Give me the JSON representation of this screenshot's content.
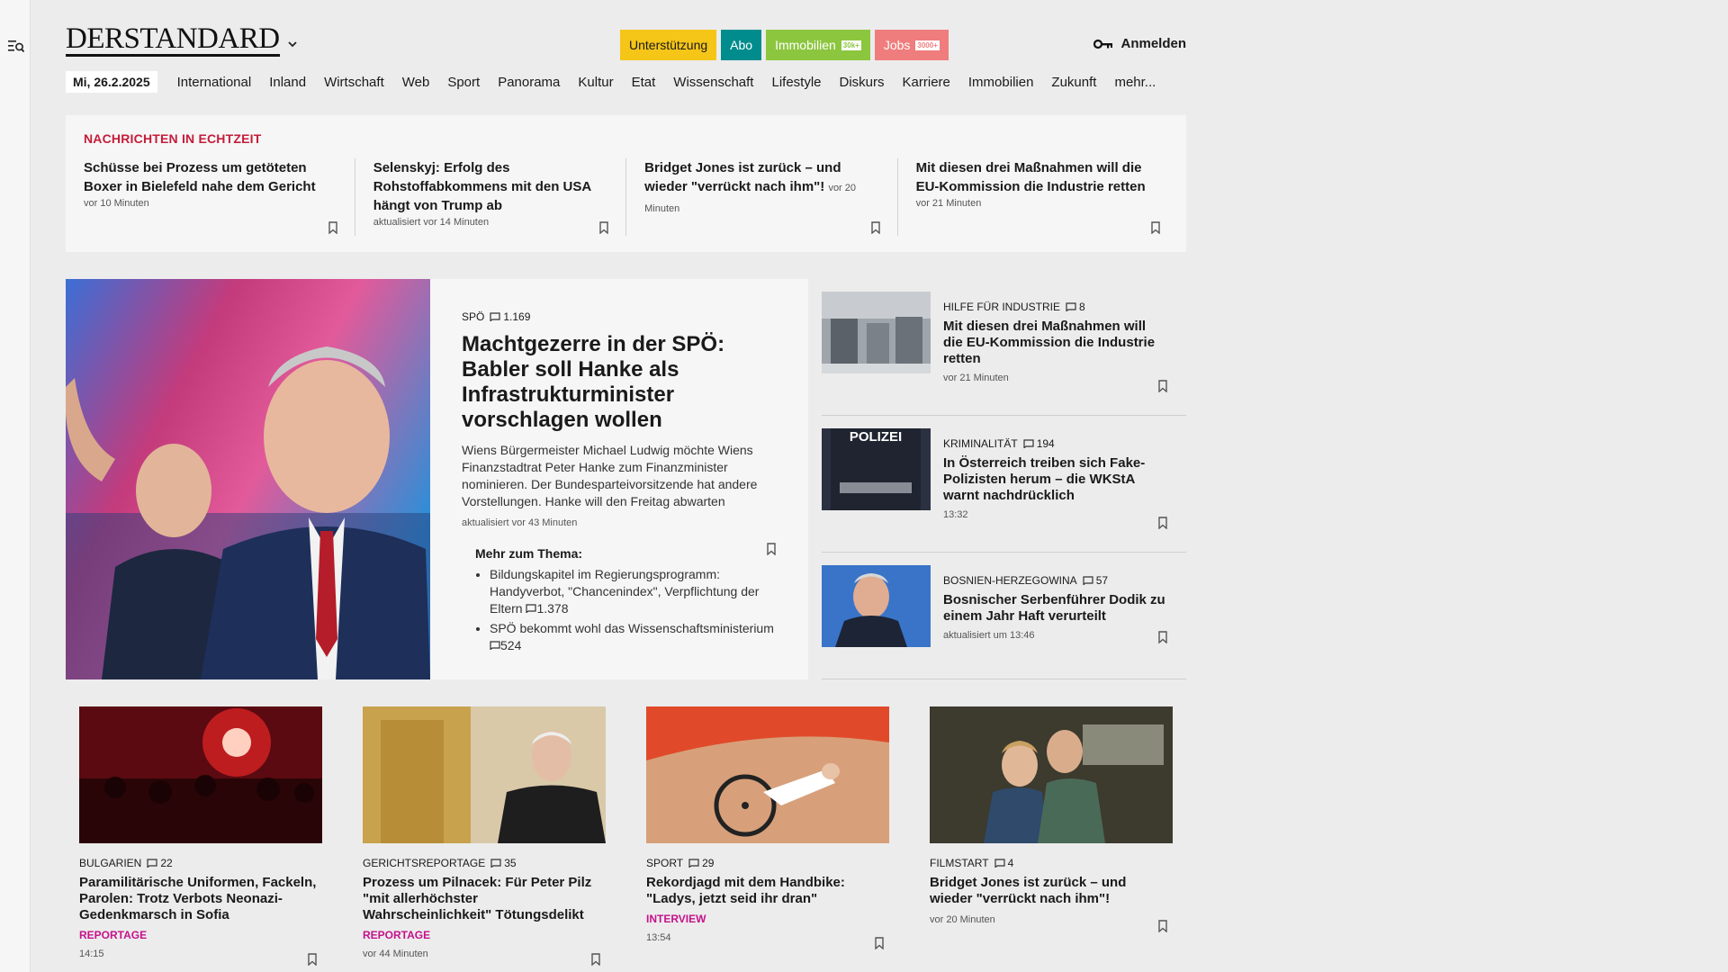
{
  "header": {
    "logo": "DERSTANDARD",
    "promo": [
      {
        "label": "Unterstützung",
        "bg": "#f5c518",
        "fg": "#1a1a1a",
        "tag": ""
      },
      {
        "label": "Abo",
        "bg": "#008c8c",
        "fg": "#ffffff",
        "tag": ""
      },
      {
        "label": "Immobilien",
        "bg": "#8cc63f",
        "fg": "#ffffff",
        "tag": "30k+"
      },
      {
        "label": "Jobs",
        "bg": "#f07d7d",
        "fg": "#ffffff",
        "tag": "3000+"
      }
    ],
    "login": "Anmelden"
  },
  "nav": {
    "date": "Mi, 26.2.2025",
    "items": [
      "International",
      "Inland",
      "Wirtschaft",
      "Web",
      "Sport",
      "Panorama",
      "Kultur",
      "Etat",
      "Wissenschaft",
      "Lifestyle",
      "Diskurs",
      "Karriere",
      "Immobilien",
      "Zukunft",
      "mehr..."
    ]
  },
  "ticker": {
    "title": "NACHRICHTEN IN ECHTZEIT",
    "items": [
      {
        "title": "Schüsse bei Prozess um getöteten Boxer in Bielefeld nahe dem Gericht",
        "time": "",
        "meta": "vor 10 Minuten"
      },
      {
        "title": "Selenskyj: Erfolg des Rohstoffabkommens mit den USA hängt von Trump ab",
        "time": "",
        "meta": "aktualisiert vor 14 Minuten"
      },
      {
        "title": "Bridget Jones ist zurück – und wieder \"verrückt nach ihm\"!",
        "time": "vor 20 Minuten",
        "meta": ""
      },
      {
        "title": "Mit diesen drei Maßnahmen will die EU-Kommission die Industrie retten",
        "time": "",
        "meta": "vor 21 Minuten"
      }
    ]
  },
  "lead": {
    "kicker": "SPÖ",
    "comments": "1.169",
    "title": "Machtgezerre in der SPÖ: Babler soll Hanke als Infrastrukturminister vorschlagen wollen",
    "teaser": "Wiens Bürgermeister Michael Ludwig möchte Wiens Finanzstadtrat Peter Hanke zum Finanzminister nominieren. Der Bundesparteivorsitzende hat andere Vorstellungen. Hanke will den Freitag abwarten",
    "meta": "aktualisiert vor 43 Minuten",
    "more_title": "Mehr zum Thema:",
    "more": [
      {
        "text": "Bildungskapitel im Regierungsprogramm: Handyverbot, \"Chancenindex\", Verpflichtung der Eltern",
        "comments": "1.378"
      },
      {
        "text": "SPÖ bekommt wohl das Wissenschaftsministerium",
        "comments": "524"
      }
    ]
  },
  "side": [
    {
      "kicker": "HILFE FÜR INDUSTRIE",
      "comments": "8",
      "title": "Mit diesen drei Maßnahmen will die EU-Kommission die Industrie retten",
      "meta": "vor 21 Minuten"
    },
    {
      "kicker": "KRIMINALITÄT",
      "comments": "194",
      "title": "In Österreich treiben sich Fake-Polizisten herum – die WKStA warnt nachdrücklich",
      "meta": "13:32",
      "img_text": "POLIZEI"
    },
    {
      "kicker": "BOSNIEN-HERZEGOWINA",
      "comments": "57",
      "title": "Bosnischer Serbenführer Dodik zu einem Jahr Haft verurteilt",
      "meta": "aktualisiert um 13:46"
    }
  ],
  "cards": [
    {
      "kicker": "BULGARIEN",
      "comments": "22",
      "title": "Paramilitärische Uniformen, Fackeln, Parolen: Trotz Verbots Neonazi-Gedenkmarsch in Sofia",
      "label": "REPORTAGE",
      "meta": "14:15"
    },
    {
      "kicker": "GERICHTSREPORTAGE",
      "comments": "35",
      "title": "Prozess um Pilnacek: Für Peter Pilz \"mit allerhöchster Wahrscheinlichkeit\" Tötungsdelikt",
      "label": "REPORTAGE",
      "meta": "vor 44 Minuten"
    },
    {
      "kicker": "SPORT",
      "comments": "29",
      "title": "Rekordjagd mit dem Handbike: \"Ladys, jetzt seid ihr dran\"",
      "label": "INTERVIEW",
      "meta": "13:54"
    },
    {
      "kicker": "FILMSTART",
      "comments": "4",
      "title": "Bridget Jones ist zurück – und wieder \"verrückt nach ihm\"!",
      "label": "",
      "meta": "vor 20 Minuten"
    }
  ]
}
